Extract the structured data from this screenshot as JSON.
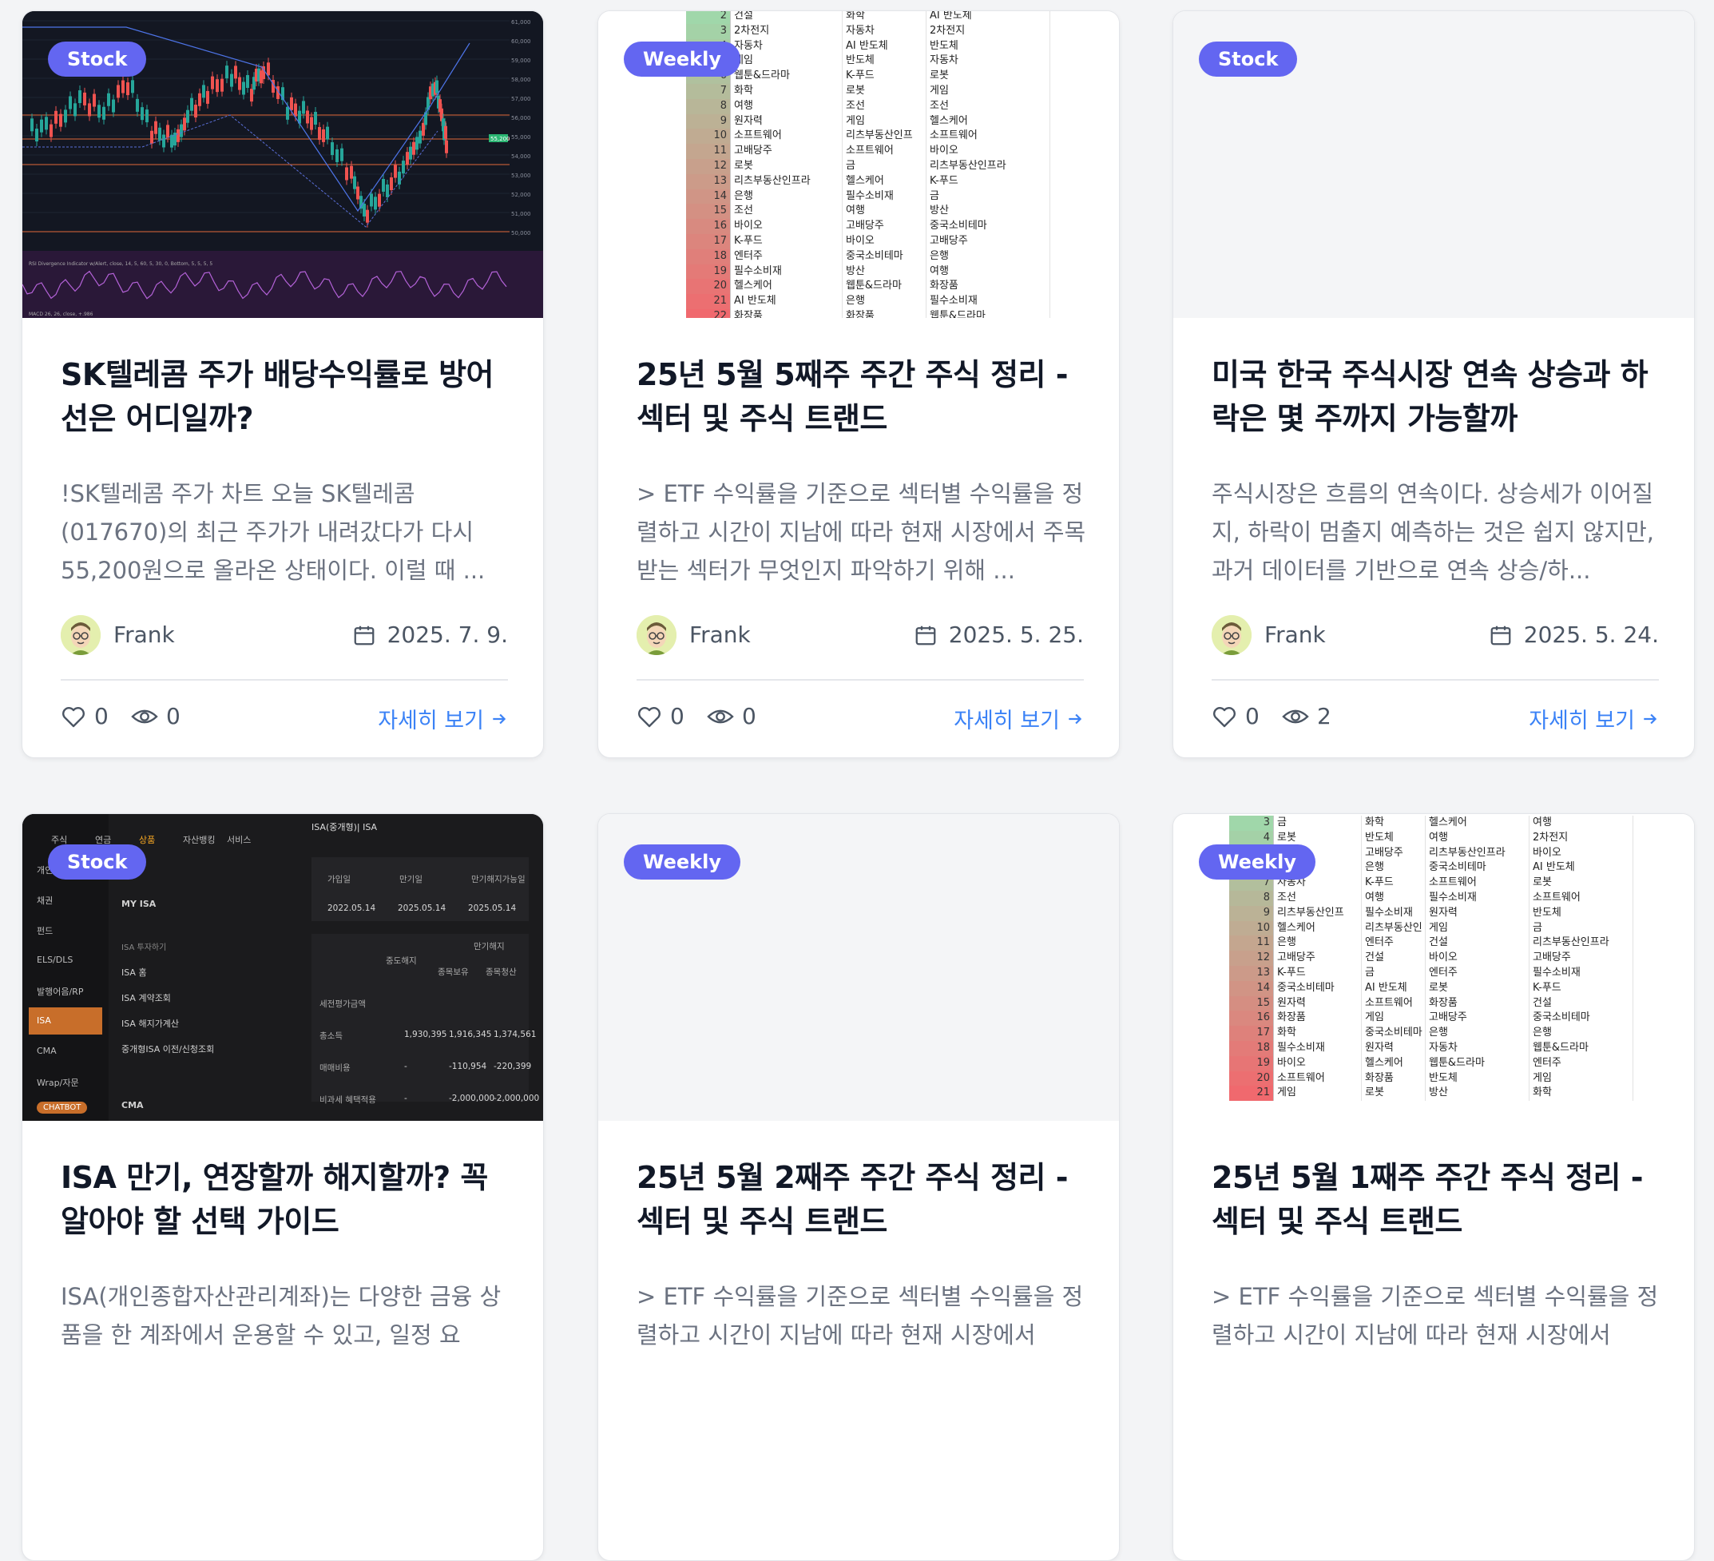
{
  "cards": [
    {
      "badge": "Stock",
      "title": "SK텔레콤 주가 배당수익률로 방어선은 어디일까?",
      "excerpt": "!SK텔레콤 주가 차트 오늘 SK텔레콤(017670)의 최근 주가가 내려갔다가 다시 55,200원으로 올라온 상태이다. 이럴 때 ...",
      "author": "Frank",
      "date": "2025. 7. 9.",
      "likes": "0",
      "views": "0",
      "more": "자세히 보기"
    },
    {
      "badge": "Weekly",
      "title": "25년 5월 5째주 주간 주식 정리 - 섹터 및 주식 트랜드",
      "excerpt": "> ETF 수익률을 기준으로 섹터별 수익률을 정렬하고 시간이 지남에 따라 현재 시장에서 주목받는 섹터가 무엇인지 파악하기 위해 ...",
      "author": "Frank",
      "date": "2025. 5. 25.",
      "likes": "0",
      "views": "0",
      "more": "자세히 보기"
    },
    {
      "badge": "Stock",
      "title": "미국 한국 주식시장 연속 상승과 하락은 몇 주까지 가능할까",
      "excerpt": "주식시장은 흐름의 연속이다. 상승세가 이어질지, 하락이 멈출지 예측하는 것은 쉽지 않지만, 과거 데이터를 기반으로 연속 상승/하...",
      "author": "Frank",
      "date": "2025. 5. 24.",
      "likes": "0",
      "views": "2",
      "more": "자세히 보기"
    },
    {
      "badge": "Stock",
      "title": "ISA 만기, 연장할까 해지할까? 꼭 알아야 할 선택 가이드",
      "excerpt": "ISA(개인종합자산관리계좌)는 다양한 금융 상품을 한 계좌에서 운용할 수 있고, 일정 요",
      "author": "",
      "date": "",
      "likes": "",
      "views": "",
      "more": ""
    },
    {
      "badge": "Weekly",
      "title": "25년 5월 2째주 주간 주식 정리 - 섹터 및 주식 트랜드",
      "excerpt": "> ETF 수익률을 기준으로 섹터별 수익률을 정렬하고 시간이 지남에 따라 현재 시장에서",
      "author": "",
      "date": "",
      "likes": "",
      "views": "",
      "more": ""
    },
    {
      "badge": "Weekly",
      "title": "25년 5월 1째주 주간 주식 정리 - 섹터 및 주식 트랜드",
      "excerpt": "> ETF 수익률을 기준으로 섹터별 수익률을 정렬하고 시간이 지남에 따라 현재 시장에서",
      "author": "",
      "date": "",
      "likes": "",
      "views": "",
      "more": ""
    }
  ],
  "sheet_a": {
    "rows": [
      [
        "2",
        "건설",
        "화학",
        "AI 반도체"
      ],
      [
        "3",
        "2차전지",
        "자동차",
        "2차전지"
      ],
      [
        "4",
        "자동차",
        "AI 반도체",
        "반도체"
      ],
      [
        "5",
        "게임",
        "반도체",
        "자동차"
      ],
      [
        "6",
        "웹툰&드라마",
        "K-푸드",
        "로봇"
      ],
      [
        "7",
        "화학",
        "로봇",
        "게임"
      ],
      [
        "8",
        "여행",
        "조선",
        "조선"
      ],
      [
        "9",
        "원자력",
        "게임",
        "헬스케어"
      ],
      [
        "10",
        "소프트웨어",
        "리츠부동산인프",
        "소프트웨어"
      ],
      [
        "11",
        "고배당주",
        "소프트웨어",
        "바이오"
      ],
      [
        "12",
        "로봇",
        "금",
        "리츠부동산인프라"
      ],
      [
        "13",
        "리츠부동산인프라",
        "헬스케어",
        "K-푸드"
      ],
      [
        "14",
        "은행",
        "필수소비재",
        "금"
      ],
      [
        "15",
        "조선",
        "여행",
        "방산"
      ],
      [
        "16",
        "바이오",
        "고배당주",
        "중국소비테마"
      ],
      [
        "17",
        "K-푸드",
        "바이오",
        "고배당주"
      ],
      [
        "18",
        "엔터주",
        "중국소비테마",
        "은행"
      ],
      [
        "19",
        "필수소비재",
        "방산",
        "여행"
      ],
      [
        "20",
        "헬스케어",
        "웹툰&드라마",
        "화장품"
      ],
      [
        "21",
        "AI 반도체",
        "은행",
        "필수소비재"
      ],
      [
        "22",
        "화장품",
        "화장품",
        "웹툰&드라마"
      ]
    ]
  },
  "sheet_b": {
    "rows": [
      [
        "3",
        "금",
        "화학",
        "헬스케어",
        "여행"
      ],
      [
        "4",
        "로봇",
        "반도체",
        "여행",
        "2차전지"
      ],
      [
        "5",
        "방산",
        "고배당주",
        "리츠부동산인프라",
        "바이오"
      ],
      [
        "6",
        "건설",
        "은행",
        "중국소비테마",
        "AI 반도체"
      ],
      [
        "7",
        "자동차",
        "K-푸드",
        "소프트웨어",
        "로봇"
      ],
      [
        "8",
        "조선",
        "여행",
        "필수소비재",
        "소프트웨어"
      ],
      [
        "9",
        "리츠부동산인프",
        "필수소비재",
        "원자력",
        "반도체"
      ],
      [
        "10",
        "헬스케어",
        "리츠부동산인",
        "게임",
        "금"
      ],
      [
        "11",
        "은행",
        "엔터주",
        "건설",
        "리츠부동산인프라"
      ],
      [
        "12",
        "고배당주",
        "건설",
        "바이오",
        "고배당주"
      ],
      [
        "13",
        "K-푸드",
        "금",
        "엔터주",
        "필수소비재"
      ],
      [
        "14",
        "중국소비테마",
        "AI 반도체",
        "로봇",
        "K-푸드"
      ],
      [
        "15",
        "원자력",
        "소프트웨어",
        "화장품",
        "건설"
      ],
      [
        "16",
        "화장품",
        "게임",
        "고배당주",
        "중국소비테마"
      ],
      [
        "17",
        "화학",
        "중국소비테마",
        "은행",
        "은행"
      ],
      [
        "18",
        "필수소비재",
        "원자력",
        "자동차",
        "웹툰&드라마"
      ],
      [
        "19",
        "바이오",
        "헬스케어",
        "웹툰&드라마",
        "엔터주"
      ],
      [
        "20",
        "소프트웨어",
        "화장품",
        "반도체",
        "게임"
      ],
      [
        "21",
        "게임",
        "로봇",
        "방산",
        "화학"
      ]
    ]
  },
  "isa": {
    "tabs": [
      "주식",
      "연금",
      "상품",
      "자산뱅킹",
      "서비스"
    ],
    "menu": [
      "개인",
      "채권",
      "펀드",
      "ELS/DLS",
      "발행어음/RP",
      "ISA",
      "CMA",
      "Wrap/자문"
    ],
    "chatbot": "CHATBOT",
    "sub": [
      "MY ISA",
      "ISA 투자하기",
      "ISA 홈",
      "ISA 계약조회",
      "ISA 해지가계산",
      "중개형ISA 이전/신청조회",
      "CMA"
    ],
    "header": "ISA(중개형)| ISA",
    "cols": [
      "가입일",
      "만기일",
      "만기해지가능일"
    ],
    "dates": [
      "2022.05.14",
      "2025.05.14",
      "2025.05.14"
    ],
    "labels": [
      "중도해지",
      "만기해지",
      "종목보유",
      "종목청산",
      "세전평가금액",
      "총소득",
      "매매비용",
      "비과세 혜택적용"
    ],
    "vals": [
      [
        "1,930,395",
        "1,916,345",
        "1,374,561"
      ],
      [
        "-",
        "-110,954",
        "-220,399"
      ],
      [
        "-",
        "-2,000,000",
        "-2,000,000"
      ]
    ]
  },
  "chart": {
    "ticks": [
      "61,000",
      "60,000",
      "59,000",
      "58,000",
      "57,000",
      "56,000",
      "55,000",
      "54,000",
      "53,000",
      "52,000",
      "51,000",
      "50,000"
    ],
    "price_tag": "55,200",
    "rsi_label": "RSI Divergence Indicator w/Alert, close, 14, 5, 60, 5, 30, 0, Bottom, 5, 5, 5, 5",
    "macd_label": "MACD 26, 26, close, +.986"
  },
  "colors": {
    "badge": "#6366f1",
    "link": "#3b82f6",
    "title": "#111827",
    "text": "#6b7280"
  }
}
